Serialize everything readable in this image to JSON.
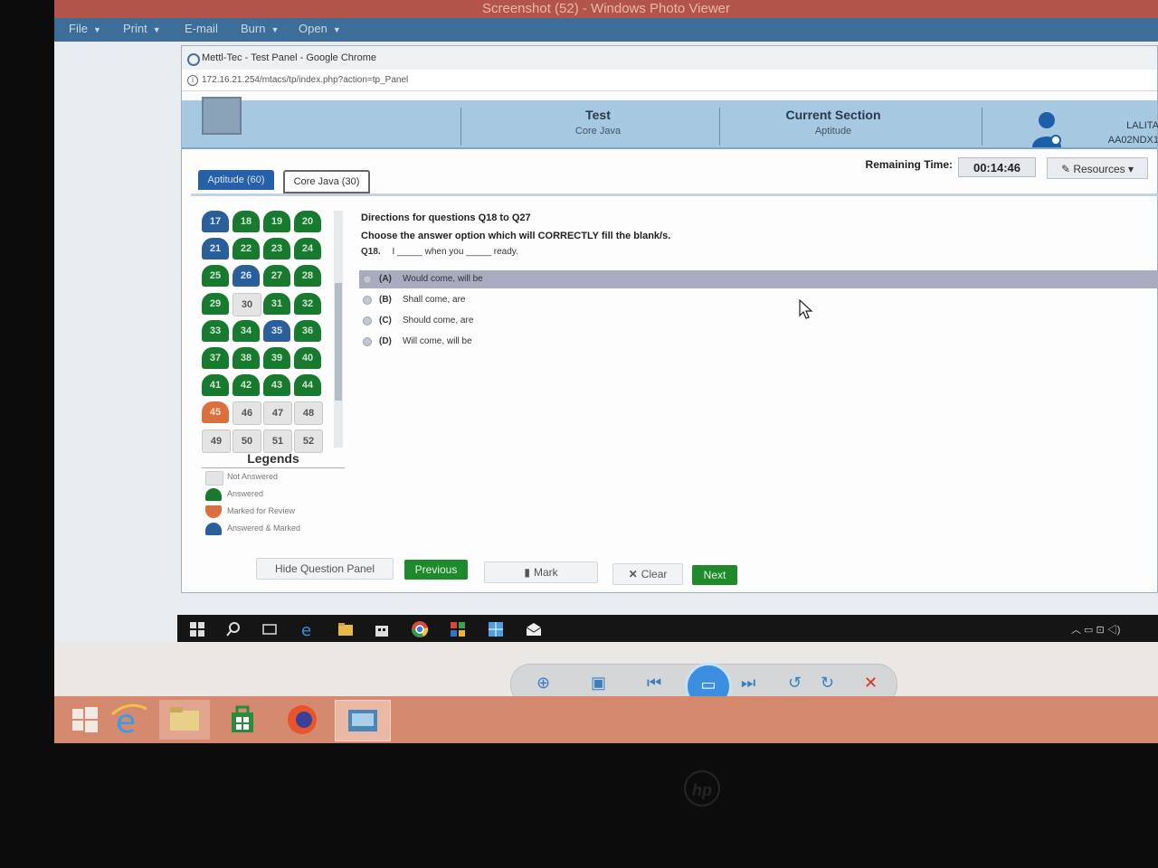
{
  "photo_viewer": {
    "title": "Screenshot (52) - Windows Photo Viewer",
    "menu": [
      "File",
      "Print",
      "E-mail",
      "Burn",
      "Open"
    ]
  },
  "browser": {
    "title": "Mettl-Tec - Test Panel - Google Chrome",
    "address": "172.16.21.254/mtacs/tp/index.php?action=tp_Panel"
  },
  "header": {
    "logo": "",
    "test_label": "Test",
    "test_value": "Core Java",
    "section_label": "Current Section",
    "section_value": "Aptitude",
    "user_name": "LALITA",
    "user_id": "AA02NDX1"
  },
  "toolbar": {
    "remaining_label": "Remaining Time:",
    "remaining_time": "00:14:46",
    "resources_label": "✎ Resources ▾"
  },
  "section_tabs": [
    {
      "label": "Aptitude (60)",
      "active": true
    },
    {
      "label": "Core Java (30)",
      "active": false
    }
  ],
  "palette": [
    {
      "n": "17",
      "state": "answered-marked"
    },
    {
      "n": "18",
      "state": "answered"
    },
    {
      "n": "19",
      "state": "answered"
    },
    {
      "n": "20",
      "state": "answered"
    },
    {
      "n": "21",
      "state": "answered-marked"
    },
    {
      "n": "22",
      "state": "answered"
    },
    {
      "n": "23",
      "state": "answered"
    },
    {
      "n": "24",
      "state": "answered"
    },
    {
      "n": "25",
      "state": "answered"
    },
    {
      "n": "26",
      "state": "answered-marked"
    },
    {
      "n": "27",
      "state": "answered"
    },
    {
      "n": "28",
      "state": "answered"
    },
    {
      "n": "29",
      "state": "answered"
    },
    {
      "n": "30",
      "state": "not-answered"
    },
    {
      "n": "31",
      "state": "answered"
    },
    {
      "n": "32",
      "state": "answered"
    },
    {
      "n": "33",
      "state": "answered"
    },
    {
      "n": "34",
      "state": "answered"
    },
    {
      "n": "35",
      "state": "answered-marked"
    },
    {
      "n": "36",
      "state": "answered"
    },
    {
      "n": "37",
      "state": "answered"
    },
    {
      "n": "38",
      "state": "answered"
    },
    {
      "n": "39",
      "state": "answered"
    },
    {
      "n": "40",
      "state": "answered"
    },
    {
      "n": "41",
      "state": "answered"
    },
    {
      "n": "42",
      "state": "answered"
    },
    {
      "n": "43",
      "state": "answered"
    },
    {
      "n": "44",
      "state": "answered"
    },
    {
      "n": "45",
      "state": "marked-review"
    },
    {
      "n": "46",
      "state": "not-answered"
    },
    {
      "n": "47",
      "state": "not-answered"
    },
    {
      "n": "48",
      "state": "not-answered"
    },
    {
      "n": "49",
      "state": "not-answered"
    },
    {
      "n": "50",
      "state": "not-answered"
    },
    {
      "n": "51",
      "state": "not-answered"
    },
    {
      "n": "52",
      "state": "not-answered"
    }
  ],
  "legends": {
    "title": "Legends",
    "items": [
      {
        "label": "Not Answered",
        "color": "#e4e4e4"
      },
      {
        "label": "Answered",
        "color": "#177a2f"
      },
      {
        "label": "Marked for Review",
        "color": "#d9703d"
      },
      {
        "label": "Answered & Marked",
        "color": "#2b5f9a"
      }
    ]
  },
  "question": {
    "directions_1": "Directions for questions Q18 to Q27",
    "directions_2": "Choose the answer option which will CORRECTLY fill the blank/s.",
    "number": "Q18.",
    "text": "I _____ when you _____ ready.",
    "options": [
      {
        "key": "(A)",
        "text": "Would come, will be",
        "selected": true
      },
      {
        "key": "(B)",
        "text": "Shall come, are",
        "selected": false
      },
      {
        "key": "(C)",
        "text": "Should come, are",
        "selected": false
      },
      {
        "key": "(D)",
        "text": "Will come, will be",
        "selected": false
      }
    ]
  },
  "buttons": {
    "hide_panel": "Hide Question Panel",
    "previous": "Previous",
    "mark": "Mark",
    "clear": "Clear",
    "next": "Next"
  },
  "colors": {
    "header_bg": "#a6c8e0",
    "answered": "#177a2f",
    "review": "#d9703d",
    "answered_marked": "#2b5f9a",
    "selected_option": "#a9acc0"
  },
  "bezel": {
    "logo": "hp"
  }
}
